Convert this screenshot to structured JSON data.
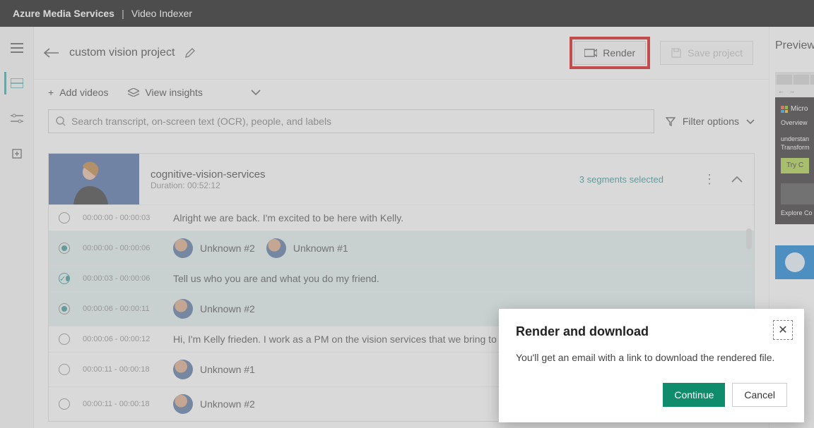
{
  "header": {
    "brand": "Azure Media Services",
    "product": "Video Indexer"
  },
  "project": {
    "name": "custom vision project"
  },
  "actions": {
    "render": "Render",
    "save": "Save project"
  },
  "toolbar": {
    "add_videos": "Add videos",
    "view_insights": "View insights"
  },
  "search": {
    "placeholder": "Search transcript, on-screen text (OCR), people, and labels",
    "filter": "Filter options"
  },
  "video": {
    "title": "cognitive-vision-services",
    "duration_label": "Duration: 00:52:12",
    "segments": "3 segments selected"
  },
  "rows": [
    {
      "time": "00:00:00 - 00:00:03",
      "text": "Alright we are back. I'm excited to be here with Kelly.",
      "selected": false,
      "type": "text"
    },
    {
      "time": "00:00:00 - 00:00:06",
      "people": [
        "Unknown #2",
        "Unknown #1"
      ],
      "selected": true,
      "type": "people"
    },
    {
      "time": "00:00:03 - 00:00:06",
      "text": "Tell us who you are and what you do my friend.",
      "selected": true,
      "type": "text",
      "checked": true
    },
    {
      "time": "00:00:06 - 00:00:11",
      "people": [
        "Unknown #2"
      ],
      "selected": true,
      "type": "people"
    },
    {
      "time": "00:00:06 - 00:00:12",
      "text": "Hi, I'm Kelly frieden. I work as a PM on the vision services that we bring to you thr",
      "selected": false,
      "type": "text"
    },
    {
      "time": "00:00:11 - 00:00:18",
      "people": [
        "Unknown #1"
      ],
      "selected": false,
      "type": "people"
    },
    {
      "time": "00:00:11 - 00:00:18",
      "people": [
        "Unknown #2"
      ],
      "selected": false,
      "type": "people"
    }
  ],
  "preview": {
    "heading": "Preview",
    "msft": "Micro",
    "overview": "Overview",
    "line1": "understan",
    "line2": "Transform",
    "try": "Try C",
    "explore": "Explore Co"
  },
  "dialog": {
    "title": "Render and download",
    "body": "You'll get an email with a link to download the rendered file.",
    "continue": "Continue",
    "cancel": "Cancel"
  }
}
